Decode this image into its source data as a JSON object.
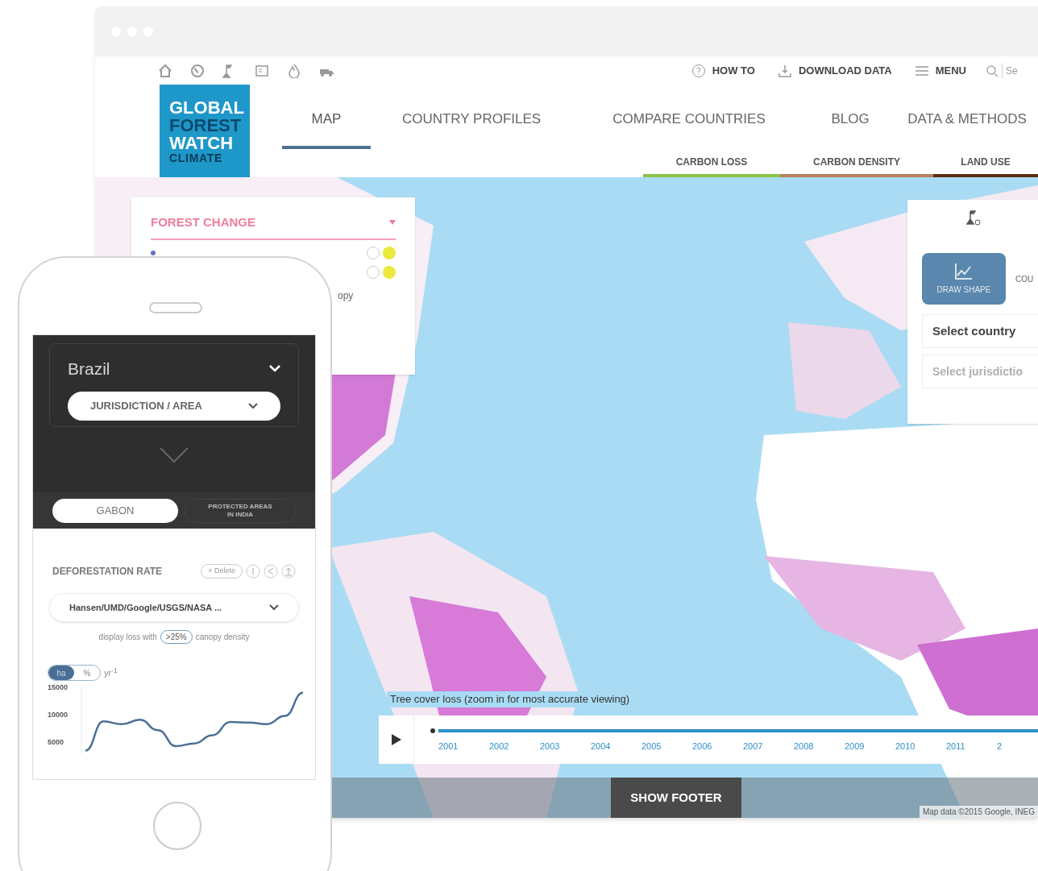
{
  "browser": {
    "toolbar_links": [
      {
        "kind": "help",
        "label": "HOW TO"
      },
      {
        "kind": "download",
        "label": "DOWNLOAD DATA"
      },
      {
        "kind": "menu",
        "label": "MENU"
      }
    ],
    "search": {
      "placeholder": "Se"
    },
    "logo": [
      "GLOBAL",
      "FOREST",
      "WATCH",
      "CLIMATE"
    ],
    "nav": [
      {
        "label": "MAP",
        "selected": true
      },
      {
        "label": "COUNTRY PROFILES",
        "selected": false
      },
      {
        "label": "COMPARE COUNTRIES",
        "selected": false
      },
      {
        "label": "BLOG",
        "selected": false
      },
      {
        "label": "DATA & METHODS",
        "selected": false
      }
    ],
    "sub_tabs": [
      {
        "label": "CARBON LOSS",
        "color": "#8bc34a"
      },
      {
        "label": "CARBON DENSITY",
        "color": "#b5805f"
      },
      {
        "label": "LAND USE",
        "color": "#5a2d12"
      }
    ],
    "layers_panel": {
      "title": "FOREST CHANGE",
      "texts": [
        "opy"
      ]
    },
    "analysis_panel": {
      "tabs": [
        {
          "label": "DRAW SHAPE",
          "selected": true
        },
        {
          "label": "COU",
          "selected": false
        }
      ],
      "country": "Select country",
      "jurisdiction": {
        "placeholder": "Select jurisdictio"
      }
    },
    "timeline": {
      "caption": "Tree cover loss (zoom in for most accurate viewing)",
      "years": [
        "2001",
        "2002",
        "2003",
        "2004",
        "2005",
        "2006",
        "2007",
        "2008",
        "2009",
        "2010",
        "2011",
        "2"
      ]
    },
    "footer_button": "SHOW FOOTER",
    "attribution": "Map data ©2015 Google, INEG"
  },
  "phone": {
    "country": "Brazil",
    "jurisdiction": "JURISDICTION / AREA",
    "tabs": [
      {
        "label": "GABON",
        "selected": true
      },
      {
        "label": "PROTECTED AREAS IN INDIA",
        "selected": false
      }
    ],
    "widget": {
      "title": "DEFORESTATION RATE",
      "delete": "× Delete",
      "source": "Hansen/UMD/Google/USGS/NASA ...",
      "sentence": [
        "display loss with",
        ">25%",
        "canopy density"
      ],
      "units": [
        {
          "label": "ha",
          "selected": true
        },
        {
          "label": "%",
          "selected": false
        }
      ],
      "unit_suffix": "yr$^{-1}$",
      "chart_data": {
        "type": "line",
        "yticks": [
          5000,
          10000,
          15000
        ],
        "ylim": [
          3000,
          15000
        ],
        "series": [
          {
            "color": "#4a6f96",
            "values": [
              3500,
              8800,
              8300,
              9100,
              7200,
              4300,
              4800,
              6300,
              8700,
              8600,
              8300,
              9800,
              14000
            ]
          }
        ]
      }
    }
  }
}
